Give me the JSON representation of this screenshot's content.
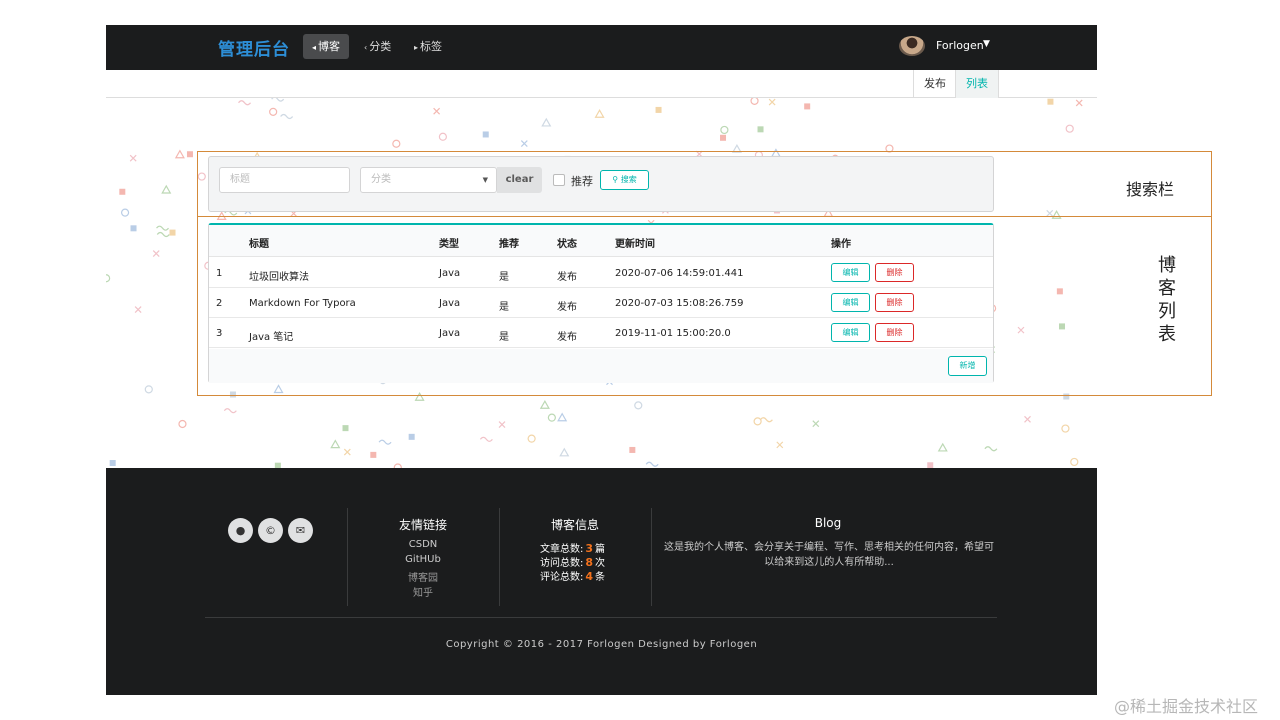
{
  "nav": {
    "brand": "管理后台",
    "items": [
      {
        "label": "博客",
        "icon": "home-icon",
        "active": true
      },
      {
        "label": "分类",
        "icon": "idea-icon",
        "active": false
      },
      {
        "label": "标签",
        "icon": "tags-icon",
        "active": false
      }
    ],
    "user": "Forlogen"
  },
  "submenu": {
    "publish": "发布",
    "list": "列表"
  },
  "search": {
    "title_placeholder": "标题",
    "category_placeholder": "分类",
    "clear_label": "clear",
    "recommend_label": "推荐",
    "search_label": "搜索"
  },
  "table": {
    "headers": [
      "标题",
      "类型",
      "推荐",
      "状态",
      "更新时间",
      "操作"
    ],
    "rows": [
      {
        "id": "1",
        "title": "垃圾回收算法",
        "type": "Java",
        "recommend": "是",
        "status": "发布",
        "updated": "2020-07-06 14:59:01.441"
      },
      {
        "id": "2",
        "title": "Markdown For Typora",
        "type": "Java",
        "recommend": "是",
        "status": "发布",
        "updated": "2020-07-03 15:08:26.759"
      },
      {
        "id": "3",
        "title": "Java 笔记",
        "type": "Java",
        "recommend": "是",
        "status": "发布",
        "updated": "2019-11-01 15:00:20.0"
      }
    ],
    "edit_label": "编辑",
    "delete_label": "删除",
    "add_label": "新增"
  },
  "annotations": {
    "search_bar": "搜索栏",
    "blog_list": "博客列表"
  },
  "footer": {
    "links_title": "友情链接",
    "links": [
      "CSDN",
      "GitHUb",
      "博客园",
      "知乎"
    ],
    "info_title": "博客信息",
    "info": [
      {
        "label": "文章总数:",
        "value": "3",
        "unit": "篇"
      },
      {
        "label": "访问总数:",
        "value": "8",
        "unit": "次"
      },
      {
        "label": "评论总数:",
        "value": "4",
        "unit": "条"
      }
    ],
    "blog_title": "Blog",
    "blog_text": "这是我的个人博客、会分享关于编程、写作、思考相关的任何内容，希望可以给来到这儿的人有所帮助...",
    "copyright": "Copyright © 2016 - 2017 Forlogen Designed by Forlogen",
    "social_icons": [
      "github-icon",
      "copyright-icon",
      "mail-icon"
    ]
  },
  "watermark": "@稀土掘金技术社区",
  "colors": {
    "accent": "#00b5ad",
    "danger": "#db2828",
    "brand": "#2d8ed6",
    "highlight": "#f2711c",
    "dark": "#1b1c1d"
  }
}
